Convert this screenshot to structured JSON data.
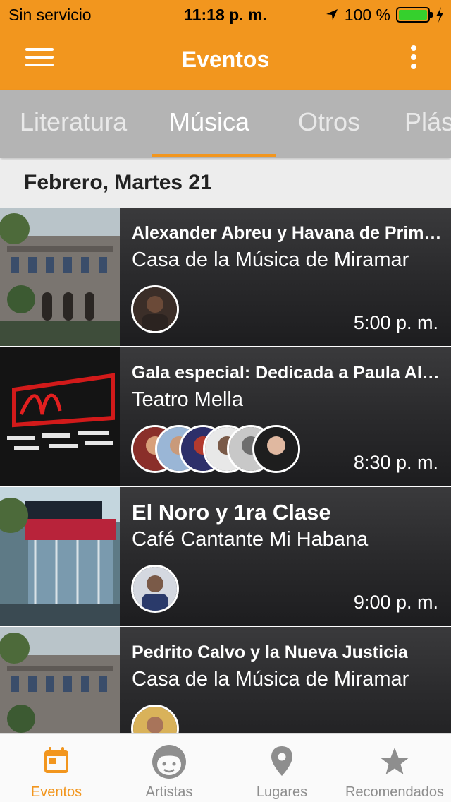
{
  "status_bar": {
    "carrier": "Sin servicio",
    "time": "11:18 p. m.",
    "battery": "100 %",
    "battery_color": "#35d02d"
  },
  "header": {
    "title": "Eventos",
    "color": "#f2961e"
  },
  "tabs": [
    {
      "label": "Literatura"
    },
    {
      "label": "Música",
      "active": true
    },
    {
      "label": "Otros"
    },
    {
      "label": "Plás"
    }
  ],
  "date_header": "Febrero, Martes 21",
  "events": [
    {
      "name": "Alexander Abreu y Havana de Primera",
      "venue": "Casa de la Música de Miramar",
      "time": "5:00 p. m.",
      "avatar_count": 1
    },
    {
      "name": "Gala especial: Dedicada a Paula Alfonso",
      "venue": "Teatro Mella",
      "time": "8:30 p. m.",
      "avatar_count": 6
    },
    {
      "name": "El Noro y 1ra Clase",
      "venue": "Café Cantante Mi Habana",
      "time": "9:00 p. m.",
      "avatar_count": 1
    },
    {
      "name": "Pedrito Calvo y la Nueva Justicia",
      "venue": "Casa de la Música de Miramar",
      "time": "",
      "avatar_count": 1
    }
  ],
  "bottom_nav": [
    {
      "label": "Eventos",
      "icon": "calendar-icon",
      "active": true
    },
    {
      "label": "Artistas",
      "icon": "face-icon"
    },
    {
      "label": "Lugares",
      "icon": "location-pin-icon"
    },
    {
      "label": "Recomendados",
      "icon": "star-icon"
    }
  ],
  "accent_color": "#f2961e",
  "inactive_color": "#8e8e8e"
}
